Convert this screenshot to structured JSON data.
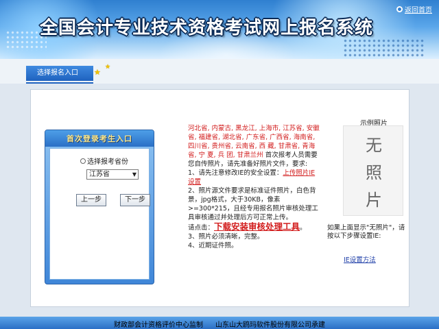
{
  "header": {
    "title": "全国会计专业技术资格考试网上报名系统",
    "back_label": "返回首页"
  },
  "tabs": {
    "active_label": "选择报名入口"
  },
  "login": {
    "header_label": "首次登录考生入口",
    "radio_label": "选择报考省份",
    "province_value": "江苏省",
    "prev_label": "上一步",
    "next_label": "下一步"
  },
  "instructions": {
    "provinces": "河北省, 内蒙古, 黑龙江, 上海市, 江苏省, 安徽省, 福建省, 湖北省, 广东省, 广西省, 海南省, 四川省, 贵州省, 云南省, 西 藏, 甘肃省, 青海省, 宁 夏, 兵 团, 甘肃兰州",
    "intro": "首次报考人员需要您自传照片，请先准备好照片文件，要求:",
    "item1_prefix": "1、请先注意修改IE的安全设置：",
    "item1_link": "上传照片IE设置",
    "item2": "2、照片源文件要求是标准证件照片，白色背景，jpg格式，大于30KB，像素>=300*215，且经专用报名照片审核处理工具审核通过并处理后方可正常上传。",
    "click_prefix": "请点击：",
    "download_link": "下载安装审核处理工具",
    "click_suffix": "。",
    "item3": "3、照片必须清晰，完整。",
    "item4": "4、近期证件照。"
  },
  "sample": {
    "caption": "示例照片",
    "placeholder_chars": [
      "无",
      "照",
      "片"
    ],
    "note": "如果上面显示\"无照片\"，请按以下步骤设置IE:",
    "ie_link": "IE设置方法"
  },
  "footer": {
    "left": "财政部会计资格评价中心监制",
    "right": "山东山大鸥玛软件股份有限公司承建"
  },
  "colors": {
    "header_blue": "#2f7fd0",
    "tab_blue": "#1f62bf",
    "alert_red": "#d21c1c",
    "footer_blue": "#2a6fc6"
  }
}
